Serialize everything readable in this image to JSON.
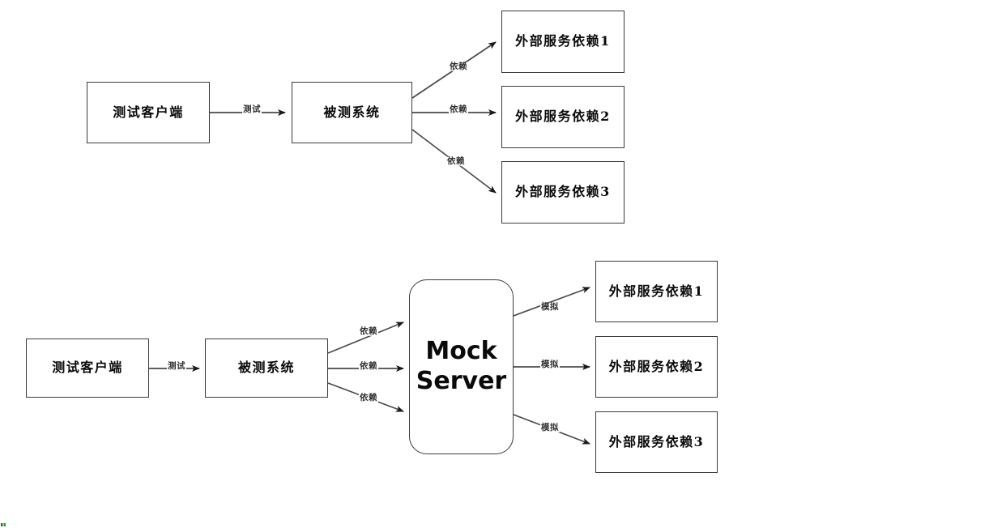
{
  "diagram": {
    "type": "flow-architecture",
    "background_color": "#ffffff",
    "stroke_color": "#3b3b3b",
    "text_color": "#0a0a0a",
    "edge_label_color": "#2f2f2f",
    "sections": [
      {
        "id": "without-mock",
        "nodes": [
          {
            "id": "t1-client",
            "label": "测试客户端"
          },
          {
            "id": "t1-sut",
            "label": "被测系统"
          },
          {
            "id": "t1-dep1",
            "label": "外部服务依赖1"
          },
          {
            "id": "t1-dep2",
            "label": "外部服务依赖2"
          },
          {
            "id": "t1-dep3",
            "label": "外部服务依赖3"
          }
        ],
        "edges": [
          {
            "id": "t1-e1",
            "from": "t1-client",
            "to": "t1-sut",
            "label": "测试"
          },
          {
            "id": "t1-e2",
            "from": "t1-sut",
            "to": "t1-dep1",
            "label": "依赖"
          },
          {
            "id": "t1-e3",
            "from": "t1-sut",
            "to": "t1-dep2",
            "label": "依赖"
          },
          {
            "id": "t1-e4",
            "from": "t1-sut",
            "to": "t1-dep3",
            "label": "依赖"
          }
        ]
      },
      {
        "id": "with-mock",
        "nodes": [
          {
            "id": "t2-client",
            "label": "测试客户端"
          },
          {
            "id": "t2-sut",
            "label": "被测系统"
          },
          {
            "id": "t2-mock",
            "label": "Mock Server"
          },
          {
            "id": "t2-dep1",
            "label": "外部服务依赖1"
          },
          {
            "id": "t2-dep2",
            "label": "外部服务依赖2"
          },
          {
            "id": "t2-dep3",
            "label": "外部服务依赖3"
          }
        ],
        "edges": [
          {
            "id": "t2-e1",
            "from": "t2-client",
            "to": "t2-sut",
            "label": "测试"
          },
          {
            "id": "t2-e2",
            "from": "t2-sut",
            "to": "t2-mock",
            "label": "依赖"
          },
          {
            "id": "t2-e3",
            "from": "t2-sut",
            "to": "t2-mock",
            "label": "依赖"
          },
          {
            "id": "t2-e4",
            "from": "t2-sut",
            "to": "t2-mock",
            "label": "依赖"
          },
          {
            "id": "t2-e5",
            "from": "t2-mock",
            "to": "t2-dep1",
            "label": "模拟"
          },
          {
            "id": "t2-e6",
            "from": "t2-mock",
            "to": "t2-dep2",
            "label": "模拟"
          },
          {
            "id": "t2-e7",
            "from": "t2-mock",
            "to": "t2-dep3",
            "label": "模拟"
          }
        ]
      }
    ]
  }
}
